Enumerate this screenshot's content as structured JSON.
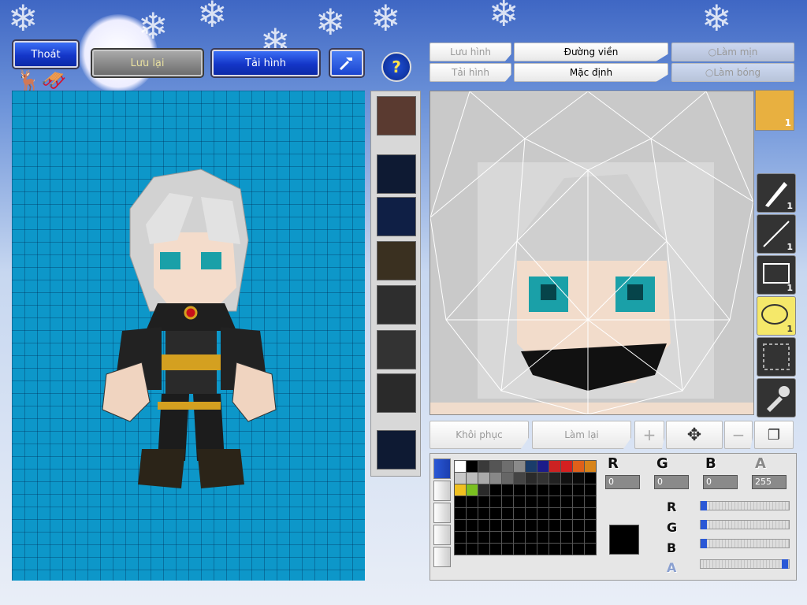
{
  "toolbar": {
    "exit_label": "Thoát",
    "save_label": "Lưu lại",
    "reload_label": "Tải hình"
  },
  "editor_tabs": {
    "save_image": "Lưu hình",
    "outline": "Đường viền",
    "load_image": "Tải hình",
    "default": "Mặc định",
    "smooth": "Làm mịn",
    "shade": "Làm bóng"
  },
  "tools": [
    {
      "name": "pen-tool",
      "count": "1"
    },
    {
      "name": "line-tool",
      "count": "1"
    },
    {
      "name": "rectangle-tool",
      "count": "1"
    },
    {
      "name": "ellipse-tool",
      "count": "1"
    },
    {
      "name": "select-tool",
      "count": ""
    },
    {
      "name": "eyedropper-tool",
      "count": ""
    }
  ],
  "avatar_count": "1",
  "actions": {
    "restore": "Khôi phục",
    "redo": "Làm lại"
  },
  "color": {
    "r_value": "0",
    "g_value": "0",
    "b_value": "0",
    "a_value": "255",
    "current": "#000000"
  },
  "palette_colors": [
    "#ffffff",
    "#000000",
    "#3a3a3a",
    "#555555",
    "#6e6e6e",
    "#8a8a8a",
    "#1a3c6a",
    "#1c1c8a",
    "#cc2222",
    "#d42020",
    "#e0601a",
    "#d8841a",
    "#c8c8c8",
    "#bcbcbc",
    "#aaaaaa",
    "#888888",
    "#666666",
    "#444444",
    "#2a2a2a",
    "#333333",
    "#222222",
    "#111111",
    "#0a0a0a",
    "#000000",
    "#f0c020",
    "#7ac020",
    "#2a2a2a"
  ]
}
